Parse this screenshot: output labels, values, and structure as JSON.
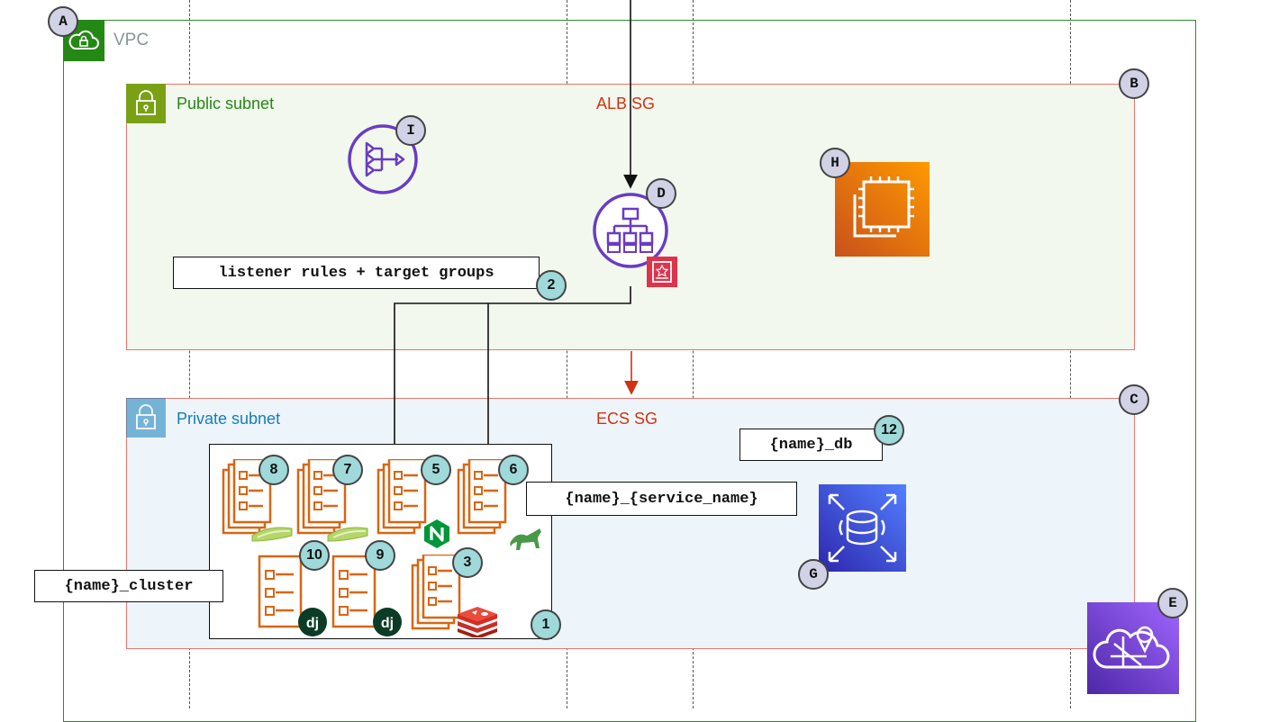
{
  "vpc": {
    "label": "VPC",
    "letter": "A"
  },
  "public_subnet": {
    "label": "Public subnet",
    "sg_label": "ALB SG",
    "letter": "B",
    "label_color": "#248814"
  },
  "private_subnet": {
    "label": "Private subnet",
    "sg_label": "ECS SG",
    "letter": "C",
    "label_color": "#147eba"
  },
  "nodes": {
    "nat_gateway": {
      "letter": "I",
      "icon": "nat-gateway-icon"
    },
    "load_balancer": {
      "letter": "D",
      "icon": "application-load-balancer-icon"
    },
    "ec2": {
      "letter": "H",
      "icon": "ec2-instance-icon"
    },
    "rds": {
      "letter": "G",
      "icon": "rds-database-icon"
    },
    "cloud_map": {
      "letter": "E",
      "icon": "cloud-map-icon"
    }
  },
  "labels": {
    "listener": "listener rules + target groups",
    "service": "{name}_{service_name}",
    "db": "{name}_db",
    "cluster": "{name}_cluster"
  },
  "badges": {
    "cluster": "1",
    "listener": "2",
    "redis": "3",
    "nginx": "5",
    "gunicorn": "6",
    "celery_beat": "7",
    "celery_worker": "8",
    "django_a": "9",
    "django_b": "10",
    "db": "12"
  },
  "colors": {
    "vpc": "#248814",
    "security_group": "#e8766d",
    "ecs": "#d86613",
    "nat_purple": "#693cc5",
    "ec2_orange": "#e9710f",
    "rds_blue": "#3f48cc",
    "cloud_map_purple": "#7b2fbe",
    "badge_teal": "#9fd9d9",
    "badge_lavender": "#d2d2e6"
  }
}
